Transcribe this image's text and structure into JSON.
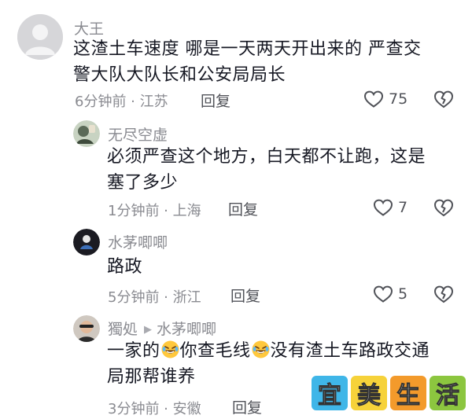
{
  "comments": [
    {
      "username": "大王",
      "line1": "这渣土车速度 哪是一天两天开出来的 严查交",
      "line2": "警大队大队长和公安局局长",
      "meta": "6分钟前 · 江苏",
      "reply_label": "回复",
      "likes": "75",
      "avatar_icon": "default-avatar-icon"
    },
    {
      "username": "无尽空虚",
      "line1": "必须严查这个地方，白天都不让跑，这是",
      "line2": "塞了多少",
      "meta": "1分钟前 · 上海",
      "reply_label": "回复",
      "likes": "7",
      "avatar_icon": "user-avatar-icon"
    },
    {
      "username": "水茅唧唧",
      "line1": "路政",
      "meta": "5分钟前 · 浙江",
      "reply_label": "回复",
      "likes": "5",
      "avatar_icon": "user-avatar-icon"
    },
    {
      "username": "獨処",
      "reply_to": "水茅唧唧",
      "line1_a": "一家的",
      "line1_b": "你查毛线",
      "line1_c": "没有渣土车路政交通",
      "line2": "局那帮谁养",
      "meta": "3分钟前 · 安徽",
      "reply_label": "回复",
      "emoji": "laughing-tears-emoji",
      "avatar_icon": "user-avatar-icon"
    }
  ],
  "watermark": {
    "chars": [
      "宜",
      "美",
      "生",
      "活"
    ],
    "colors": [
      "#3fb6e8",
      "#f6d23a",
      "#f39a2b",
      "#8cc63f"
    ]
  },
  "icons": {
    "like": "heart-outline-icon",
    "dislike": "broken-heart-outline-icon"
  }
}
